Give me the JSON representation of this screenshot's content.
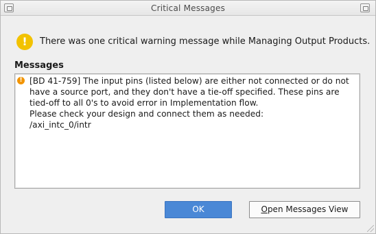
{
  "window": {
    "title": "Critical Messages"
  },
  "summary": {
    "icon": "warning-icon",
    "text": "There was one critical warning message while Managing Output Products."
  },
  "messages": {
    "label": "Messages",
    "items": [
      {
        "icon": "critical-warning-icon",
        "text": "[BD 41-759] The input pins (listed below) are either not connected or do not have a source port, and they don't have a tie-off specified. These pins are tied-off to all 0's to avoid error in Implementation flow.\nPlease check your design and connect them as needed:\n/axi_intc_0/intr"
      }
    ]
  },
  "buttons": {
    "ok_label": "OK",
    "open_messages_label_mnemonic": "O",
    "open_messages_label_rest": "pen Messages View"
  },
  "colors": {
    "ok_button_bg": "#4a88d6",
    "warning_icon": "#f2c200",
    "critical_icon": "#f29400"
  }
}
